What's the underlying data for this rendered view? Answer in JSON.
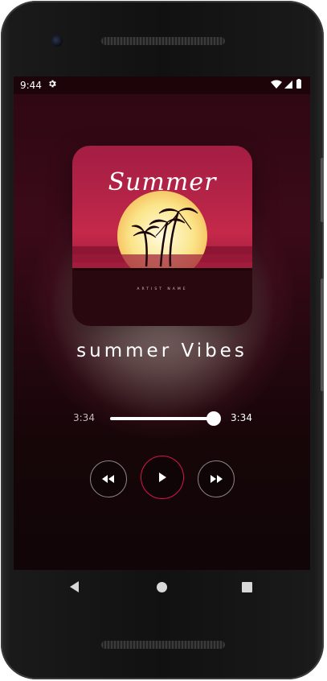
{
  "status_bar": {
    "time": "9:44",
    "icons": [
      "settings-gear-icon",
      "wifi-icon",
      "cell-signal-icon",
      "battery-icon"
    ]
  },
  "album_art": {
    "title": "Summer",
    "artist": "ARTIST NAME"
  },
  "song": {
    "title": "summer Vibes"
  },
  "progress": {
    "elapsed": "3:34",
    "total": "3:34",
    "position_fraction": 1.0
  },
  "controls": {
    "icons": [
      "rewind-icon",
      "play-icon",
      "fast-forward-icon"
    ]
  },
  "nav_bar": {
    "icons": [
      "back-icon",
      "home-icon",
      "recents-icon"
    ]
  },
  "colors": {
    "accent": "#d8154a",
    "background_top": "#3b0a18",
    "background_bottom": "#110507",
    "album_sky": "#b52447",
    "sun": "#fbe58a"
  }
}
